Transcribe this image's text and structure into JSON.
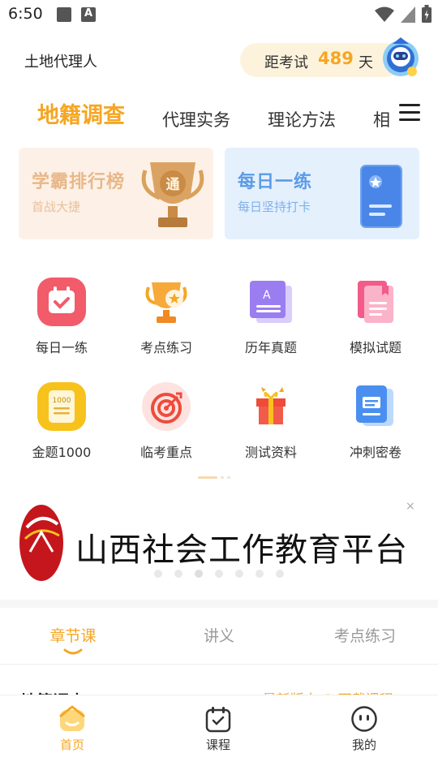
{
  "status_bar": {
    "time": "6:50"
  },
  "header": {
    "title": "土地代理人",
    "exam_countdown": {
      "label": "距考试",
      "days": "489",
      "unit": "天"
    }
  },
  "subject_tabs": [
    "地籍调查",
    "代理实务",
    "理论方法",
    "相"
  ],
  "promos": {
    "rank": {
      "title": "学霸排行榜",
      "subtitle": "首战大捷",
      "trophy_char": "通"
    },
    "daily": {
      "title": "每日一练",
      "subtitle": "每日坚持打卡"
    }
  },
  "grid_items": [
    {
      "label": "每日一练",
      "icon": "calendar-check-icon"
    },
    {
      "label": "考点练习",
      "icon": "trophy-icon"
    },
    {
      "label": "历年真题",
      "icon": "document-a-icon"
    },
    {
      "label": "模拟试题",
      "icon": "mock-paper-icon"
    },
    {
      "label": "金题1000",
      "icon": "notebook-1000-icon",
      "badge": "1000"
    },
    {
      "label": "临考重点",
      "icon": "target-icon"
    },
    {
      "label": "测试资料",
      "icon": "gift-box-icon"
    },
    {
      "label": "冲刺密卷",
      "icon": "file-stack-icon"
    }
  ],
  "banner": {
    "text": "山西社会工作教育平台",
    "close": "×"
  },
  "course_tabs": [
    "章节课",
    "讲义",
    "考点练习"
  ],
  "chapter_peek": {
    "title": "地籍调查",
    "actions": "→ 最新版本  ⇩ 下载课程"
  },
  "bottom_nav": [
    {
      "label": "首页",
      "icon": "home-icon"
    },
    {
      "label": "课程",
      "icon": "course-calendar-icon"
    },
    {
      "label": "我的",
      "icon": "profile-face-icon"
    }
  ],
  "colors": {
    "accent": "#f5a623",
    "pill_bg": "#fdf3dd",
    "rank_bg": "#fdf1e7",
    "daily_bg": "#e5f0fd"
  }
}
